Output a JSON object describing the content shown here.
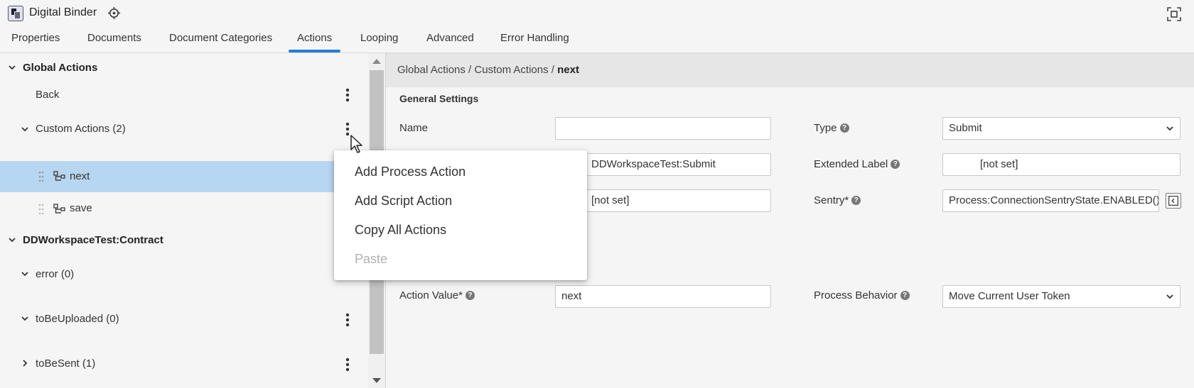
{
  "app": {
    "title": "Digital Binder",
    "target_icon": "crosshair-icon",
    "fullscreen_icon": "fullscreen-icon"
  },
  "tabs": [
    {
      "label": "Properties"
    },
    {
      "label": "Documents"
    },
    {
      "label": "Document Categories"
    },
    {
      "label": "Actions",
      "active": true
    },
    {
      "label": "Looping"
    },
    {
      "label": "Advanced"
    },
    {
      "label": "Error Handling"
    }
  ],
  "tree": {
    "global_actions": {
      "label": "Global Actions",
      "expanded": true
    },
    "back": {
      "label": "Back"
    },
    "custom_actions": {
      "label": "Custom Actions (2)",
      "expanded": true
    },
    "next": {
      "label": "next",
      "selected": true
    },
    "save": {
      "label": "save"
    },
    "contract": {
      "label": "DDWorkspaceTest:Contract",
      "expanded": true
    },
    "error": {
      "label": "error (0)"
    },
    "to_be_uploaded": {
      "label": "toBeUploaded (0)"
    },
    "to_be_sent": {
      "label": "toBeSent (1)",
      "expanded": false
    }
  },
  "breadcrumb": {
    "parts": "Global Actions / Custom Actions / ",
    "current": "next"
  },
  "general_settings": {
    "title": "General Settings",
    "name_label": "Name",
    "name_value": "",
    "type_label": "Type",
    "type_value": "Submit",
    "row2_value": "DDWorkspaceTest:Submit",
    "extended_label_label": "Extended Label",
    "extended_label_value": "[not set]",
    "row3_value": "[not set]",
    "sentry_label": "Sentry*",
    "sentry_value": "Process:ConnectionSentryState.ENABLED()",
    "action_value_label": "Action Value*",
    "action_value_value": "next",
    "process_behavior_label": "Process Behavior",
    "process_behavior_value": "Move Current User Token"
  },
  "context_menu": {
    "items": [
      {
        "label": "Add Process Action",
        "enabled": true
      },
      {
        "label": "Add Script Action",
        "enabled": true
      },
      {
        "label": "Copy All Actions",
        "enabled": true
      },
      {
        "label": "Paste",
        "enabled": false
      }
    ]
  },
  "colors": {
    "accent": "#1e7fd4",
    "selected_row": "#b7d6f2",
    "breadcrumb_bg": "#e6e6e6"
  }
}
